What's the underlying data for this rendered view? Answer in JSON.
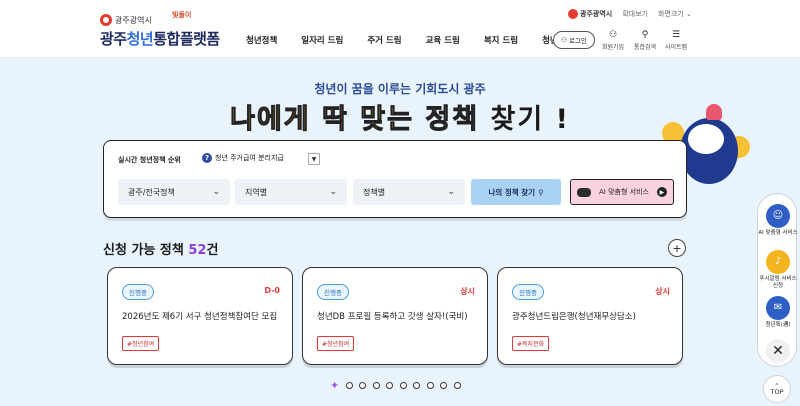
{
  "header": {
    "city_name": "광주광역시",
    "logo_prefix": "광주",
    "logo_highlight": "청년",
    "logo_suffix": "통합플랫폼",
    "mascot_label": "빛돌이",
    "nav": [
      "청년정책",
      "일자리 드림",
      "주거 드림",
      "교육 드림",
      "복지 드림",
      "청년참여"
    ],
    "top_links": {
      "city": "광주광역시",
      "zoom_in": "확대보기",
      "zoom_out": "화면크기"
    },
    "login": "로그인",
    "utils": [
      {
        "label": "회원가입",
        "icon": "user-plus-icon"
      },
      {
        "label": "통합검색",
        "icon": "search-icon"
      },
      {
        "label": "사이트맵",
        "icon": "menu-icon"
      }
    ]
  },
  "hero": {
    "subtitle": "청년이 꿈을 이루는 기회도시 광주",
    "title_parts": [
      "나에게",
      "딱",
      "맞는",
      "정책",
      "찾기 !"
    ]
  },
  "search": {
    "realtime_label": "실시간 청년정책 순위",
    "realtime_rank": "?",
    "realtime_item": "청년 주거급여 분리지급",
    "filters": [
      "광주/전국정책",
      "지역별",
      "정책별"
    ],
    "find_button": "나의 정책 찾기",
    "ai_button": "AI 맞춤형 서비스"
  },
  "available": {
    "title": "신청 가능 정책",
    "count": "52",
    "unit": "건",
    "cards": [
      {
        "status": "진행중",
        "dday": "D-0",
        "title": "2026년도 제6기 서구 청년정책참여단 모집",
        "tag": "#청년참여"
      },
      {
        "status": "진행중",
        "dday": "상시",
        "title": "청년DB 프로필 등록하고 갓생 살자!(국비)",
        "tag": "#청년참여"
      },
      {
        "status": "진행중",
        "dday": "상시",
        "title": "광주청년드림은행(청년재무상담소)",
        "tag": "#복지문화"
      }
    ]
  },
  "quick_menu": [
    {
      "label": "AI 맞춤형 서비스",
      "icon": "robot-icon"
    },
    {
      "label": "푸시알림 서비스 신청",
      "icon": "bell-icon"
    },
    {
      "label": "청년톡(通)",
      "icon": "chat-icon"
    }
  ],
  "top_button": "TOP",
  "colors": {
    "accent": "#8b3fd6",
    "primary": "#1d2a5c",
    "danger": "#e0393a",
    "background": "#e9f3fb"
  }
}
